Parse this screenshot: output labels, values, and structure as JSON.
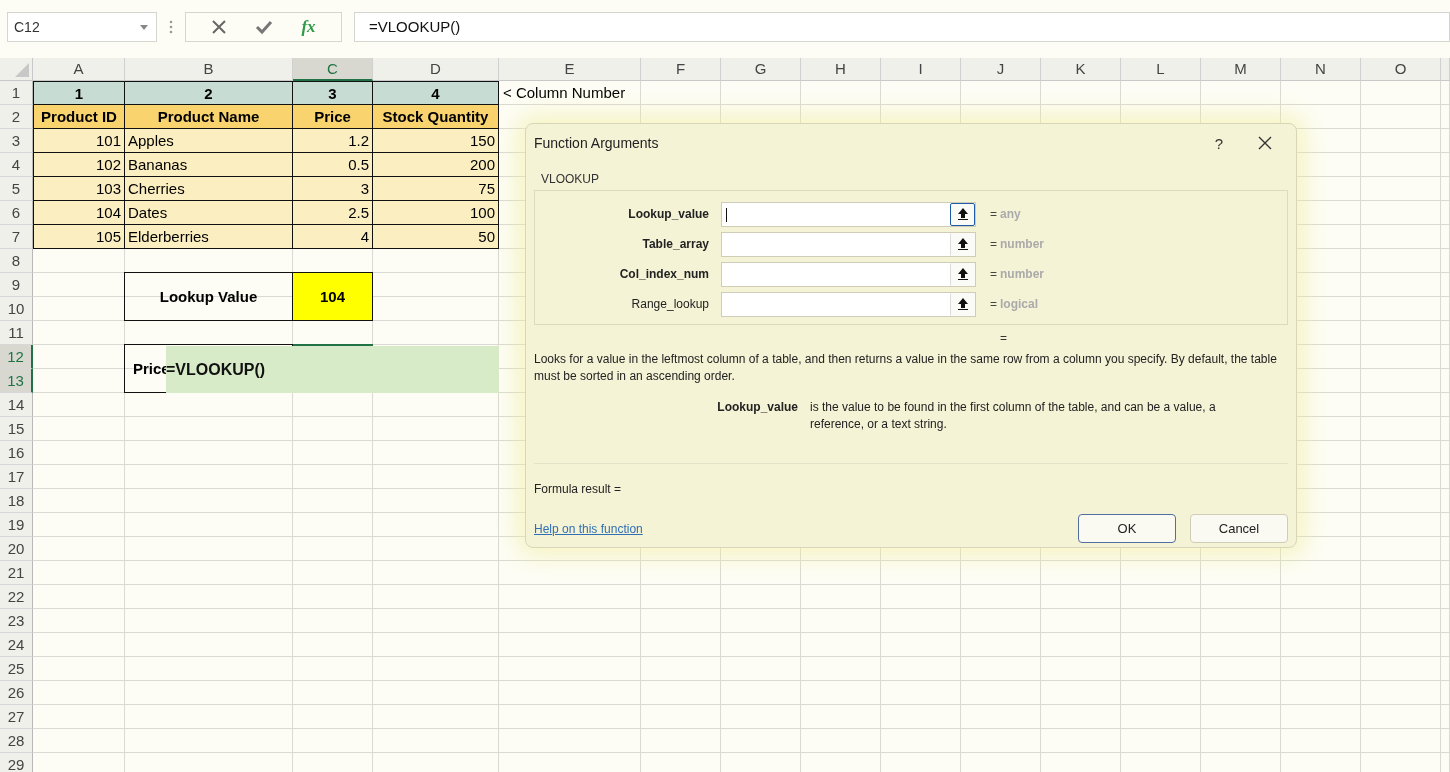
{
  "formula_bar": {
    "name_box": "C12",
    "function_button": "fx",
    "formula": "=VLOOKUP()"
  },
  "sheet": {
    "columns": [
      {
        "label": "A",
        "selected": false
      },
      {
        "label": "B",
        "selected": false
      },
      {
        "label": "C",
        "selected": true
      },
      {
        "label": "D",
        "selected": false
      },
      {
        "label": "E",
        "selected": false
      },
      {
        "label": "F",
        "selected": false
      },
      {
        "label": "G",
        "selected": false
      },
      {
        "label": "H",
        "selected": false
      },
      {
        "label": "I",
        "selected": false
      },
      {
        "label": "J",
        "selected": false
      },
      {
        "label": "K",
        "selected": false
      },
      {
        "label": "L",
        "selected": false
      },
      {
        "label": "M",
        "selected": false
      },
      {
        "label": "N",
        "selected": false
      },
      {
        "label": "O",
        "selected": false
      }
    ],
    "rows": [
      {
        "label": "1",
        "selected": false
      },
      {
        "label": "2",
        "selected": false
      },
      {
        "label": "3",
        "selected": false
      },
      {
        "label": "4",
        "selected": false
      },
      {
        "label": "5",
        "selected": false
      },
      {
        "label": "6",
        "selected": false
      },
      {
        "label": "7",
        "selected": false
      },
      {
        "label": "8",
        "selected": false
      },
      {
        "label": "9",
        "selected": false
      },
      {
        "label": "10",
        "selected": false
      },
      {
        "label": "11",
        "selected": false
      },
      {
        "label": "12",
        "selected": true
      },
      {
        "label": "13",
        "selected": true
      },
      {
        "label": "14",
        "selected": false
      },
      {
        "label": "15",
        "selected": false
      },
      {
        "label": "16",
        "selected": false
      },
      {
        "label": "17",
        "selected": false
      },
      {
        "label": "18",
        "selected": false
      },
      {
        "label": "19",
        "selected": false
      },
      {
        "label": "20",
        "selected": false
      },
      {
        "label": "21",
        "selected": false
      },
      {
        "label": "22",
        "selected": false
      },
      {
        "label": "23",
        "selected": false
      },
      {
        "label": "24",
        "selected": false
      },
      {
        "label": "25",
        "selected": false
      },
      {
        "label": "26",
        "selected": false
      },
      {
        "label": "27",
        "selected": false
      },
      {
        "label": "28",
        "selected": false
      },
      {
        "label": "29",
        "selected": false
      }
    ],
    "column_numbers": [
      "1",
      "2",
      "3",
      "4"
    ],
    "column_number_note": "< Column Number",
    "table_header": [
      "Product ID",
      "Product Name",
      "Price",
      "Stock Quantity"
    ],
    "table_rows": [
      [
        "101",
        "Apples",
        "1.2",
        "150"
      ],
      [
        "102",
        "Bananas",
        "0.5",
        "200"
      ],
      [
        "103",
        "Cherries",
        "3",
        "75"
      ],
      [
        "104",
        "Dates",
        "2.5",
        "100"
      ],
      [
        "105",
        "Elderberries",
        "4",
        "50"
      ]
    ],
    "lookup": {
      "label": "Lookup Value",
      "value": "104"
    },
    "result": {
      "label": "Price",
      "formula": "=VLOOKUP()"
    }
  },
  "dialog": {
    "title": "Function Arguments",
    "help_button": "?",
    "function_name": "VLOOKUP",
    "arguments": [
      {
        "name": "Lookup_value",
        "required": true,
        "focused": true,
        "equals": "=",
        "type": "any"
      },
      {
        "name": "Table_array",
        "required": true,
        "focused": false,
        "equals": "=",
        "type": "number"
      },
      {
        "name": "Col_index_num",
        "required": true,
        "focused": false,
        "equals": "=",
        "type": "number"
      },
      {
        "name": "Range_lookup",
        "required": false,
        "focused": false,
        "equals": "=",
        "type": "logical"
      }
    ],
    "result_equals": "=",
    "description": "Looks for a value in the leftmost column of a table, and then returns a value in the same row from a column you specify. By default, the table must be sorted in an ascending order.",
    "argument_help": {
      "name": "Lookup_value",
      "text": "is the value to be found in the first column of the table, and can be a value, a reference, or a text string."
    },
    "formula_result": "Formula result =",
    "help_link": "Help on this function",
    "buttons": [
      {
        "label": "OK",
        "kind": "default"
      },
      {
        "label": "Cancel",
        "kind": "normal"
      }
    ]
  }
}
